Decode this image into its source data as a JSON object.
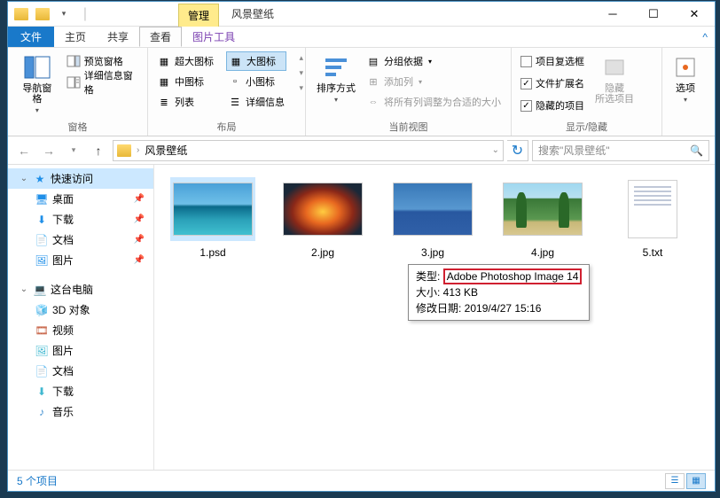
{
  "titlebar": {
    "context_tab": "管理",
    "title": "风景壁纸"
  },
  "menu": {
    "file": "文件",
    "home": "主页",
    "share": "共享",
    "view": "查看",
    "picture_tools": "图片工具"
  },
  "ribbon": {
    "nav_pane": "导航窗格",
    "preview_pane": "预览窗格",
    "details_pane": "详细信息窗格",
    "panes_label": "窗格",
    "xl_icons": "超大图标",
    "l_icons": "大图标",
    "m_icons": "中图标",
    "s_icons": "小图标",
    "list": "列表",
    "details": "详细信息",
    "layout_label": "布局",
    "sort_by": "排序方式",
    "group_by": "分组依据",
    "add_column": "添加列",
    "fit_columns": "将所有列调整为合适的大小",
    "current_view_label": "当前视图",
    "item_checkboxes": "项目复选框",
    "file_ext": "文件扩展名",
    "hidden_items": "隐藏的项目",
    "hide_selected": "隐藏\n所选项目",
    "show_hide_label": "显示/隐藏",
    "options": "选项"
  },
  "address": {
    "folder": "风景壁纸"
  },
  "search": {
    "placeholder": "搜索\"风景壁纸\""
  },
  "sidebar": {
    "quick_access": "快速访问",
    "desktop": "桌面",
    "downloads": "下载",
    "documents": "文档",
    "pictures": "图片",
    "this_pc": "这台电脑",
    "d3d": "3D 对象",
    "videos": "视频",
    "pictures2": "图片",
    "documents2": "文档",
    "downloads2": "下载",
    "music": "音乐"
  },
  "files": [
    {
      "name": "1.psd"
    },
    {
      "name": "2.jpg"
    },
    {
      "name": "3.jpg"
    },
    {
      "name": "4.jpg"
    },
    {
      "name": "5.txt"
    }
  ],
  "tooltip": {
    "type_label": "类型",
    "type_value": "Adobe Photoshop Image 14",
    "size": "大小: 413 KB",
    "modified": "修改日期: 2019/4/27 15:16"
  },
  "statusbar": {
    "count": "5 个项目"
  },
  "checkboxes": {
    "item_cb": false,
    "file_ext": true,
    "hidden": true
  }
}
